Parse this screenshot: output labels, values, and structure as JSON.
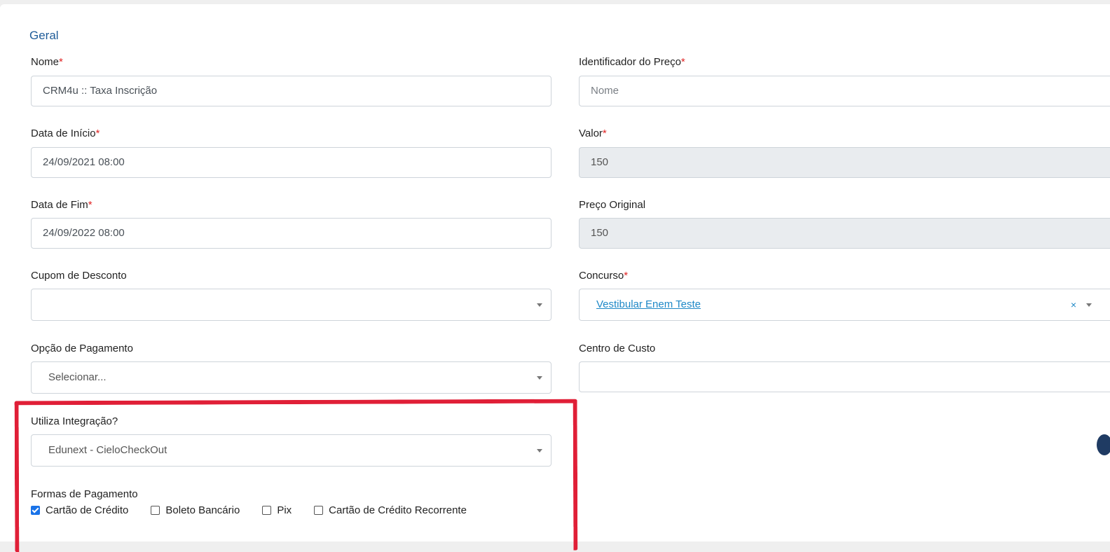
{
  "section": {
    "title": "Geral"
  },
  "required_mark": "*",
  "left": {
    "nome": {
      "label": "Nome",
      "value": "CRM4u :: Taxa Inscrição"
    },
    "data_inicio": {
      "label": "Data de Início",
      "value": "24/09/2021 08:00"
    },
    "data_fim": {
      "label": "Data de Fim",
      "value": "24/09/2022 08:00"
    },
    "cupom": {
      "label": "Cupom de Desconto",
      "value": ""
    },
    "opcao_pagamento": {
      "label": "Opção de Pagamento",
      "value": "Selecionar..."
    },
    "integracao": {
      "label": "Utiliza Integração?",
      "value": "Edunext - CieloCheckOut"
    },
    "formas": {
      "label": "Formas de Pagamento",
      "options": [
        {
          "label": "Cartão de Crédito",
          "checked": true
        },
        {
          "label": "Boleto Bancário",
          "checked": false
        },
        {
          "label": "Pix",
          "checked": false
        },
        {
          "label": "Cartão de Crédito Recorrente",
          "checked": false
        }
      ]
    }
  },
  "right": {
    "identificador": {
      "label": "Identificador do Preço",
      "placeholder": "Nome"
    },
    "valor": {
      "label": "Valor",
      "value": "150"
    },
    "preco_original": {
      "label": "Preço Original",
      "value": "150"
    },
    "concurso": {
      "label": "Concurso",
      "value": "Vestibular Enem Teste",
      "clear": "×"
    },
    "centro_custo": {
      "label": "Centro de Custo",
      "value": ""
    }
  },
  "colors": {
    "accent": "#1f5c99",
    "required": "#e02424",
    "highlight": "#e01f37",
    "link": "#1e88c7"
  }
}
